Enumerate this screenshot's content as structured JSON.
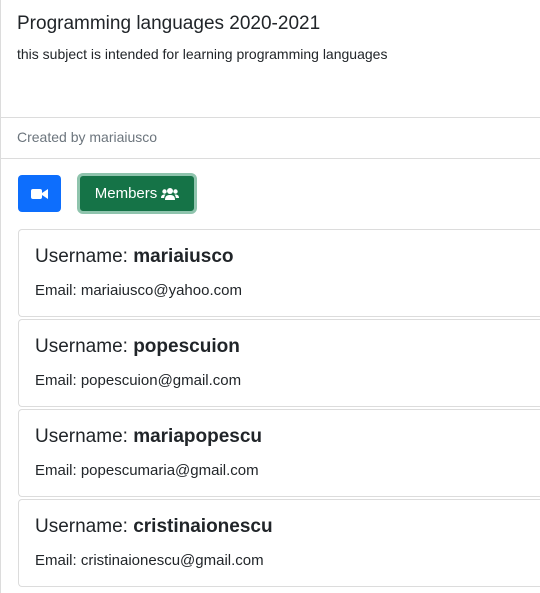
{
  "subject": {
    "title": "Programming languages 2020-2021",
    "description": "this subject is intended for learning programming languages",
    "created_by": "Created by mariaiusco"
  },
  "toolbar": {
    "video_icon": "video-camera-icon",
    "members_label": "Members",
    "members_icon": "users-icon"
  },
  "members": [
    {
      "username_label": "Username: ",
      "username": "mariaiusco",
      "email": "Email: mariaiusco@yahoo.com"
    },
    {
      "username_label": "Username: ",
      "username": "popescuion",
      "email": "Email: popescuion@gmail.com"
    },
    {
      "username_label": "Username: ",
      "username": "mariapopescu",
      "email": "Email: popescumaria@gmail.com"
    },
    {
      "username_label": "Username: ",
      "username": "cristinaionescu",
      "email": "Email: cristinaionescu@gmail.com"
    }
  ],
  "colors": {
    "primary": "#0d6efd",
    "success": "#157347",
    "muted": "#6c757d"
  }
}
